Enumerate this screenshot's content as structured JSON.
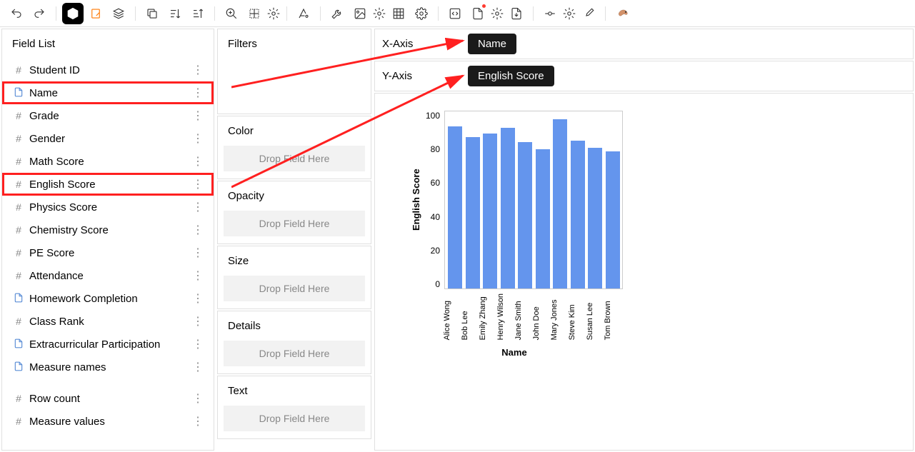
{
  "field_list": {
    "header": "Field List",
    "items": [
      {
        "icon": "#",
        "label": "Student ID"
      },
      {
        "icon": "dim",
        "label": "Name",
        "highlighted": true
      },
      {
        "icon": "#",
        "label": "Grade"
      },
      {
        "icon": "#",
        "label": "Gender"
      },
      {
        "icon": "#",
        "label": "Math Score"
      },
      {
        "icon": "#",
        "label": "English Score",
        "highlighted": true
      },
      {
        "icon": "#",
        "label": "Physics Score"
      },
      {
        "icon": "#",
        "label": "Chemistry Score"
      },
      {
        "icon": "#",
        "label": "PE Score"
      },
      {
        "icon": "#",
        "label": "Attendance"
      },
      {
        "icon": "dim",
        "label": "Homework Completion"
      },
      {
        "icon": "#",
        "label": "Class Rank"
      },
      {
        "icon": "dim",
        "label": "Extracurricular Participation"
      },
      {
        "icon": "dim",
        "label": "Measure names"
      }
    ],
    "aggregate_items": [
      {
        "icon": "#",
        "label": "Row count"
      },
      {
        "icon": "#",
        "label": "Measure values"
      }
    ]
  },
  "encodings": {
    "filters": "Filters",
    "color": "Color",
    "opacity": "Opacity",
    "size": "Size",
    "details": "Details",
    "text": "Text",
    "drop_placeholder": "Drop Field Here"
  },
  "axes": {
    "x_label": "X-Axis",
    "y_label": "Y-Axis",
    "x_chip": "Name",
    "y_chip": "English Score"
  },
  "chart_data": {
    "type": "bar",
    "xlabel": "Name",
    "ylabel": "English Score",
    "ylim": [
      0,
      100
    ],
    "yticks": [
      0,
      20,
      40,
      60,
      80,
      100
    ],
    "categories": [
      "Alice Wong",
      "Bob Lee",
      "Emily Zhang",
      "Henry Wilson",
      "Jane Smith",
      "John Doe",
      "Mary Jones",
      "Steve Kim",
      "Susan Lee",
      "Tom Brown"
    ],
    "values": [
      91,
      85,
      87,
      90,
      82,
      78,
      95,
      83,
      79,
      77
    ]
  }
}
